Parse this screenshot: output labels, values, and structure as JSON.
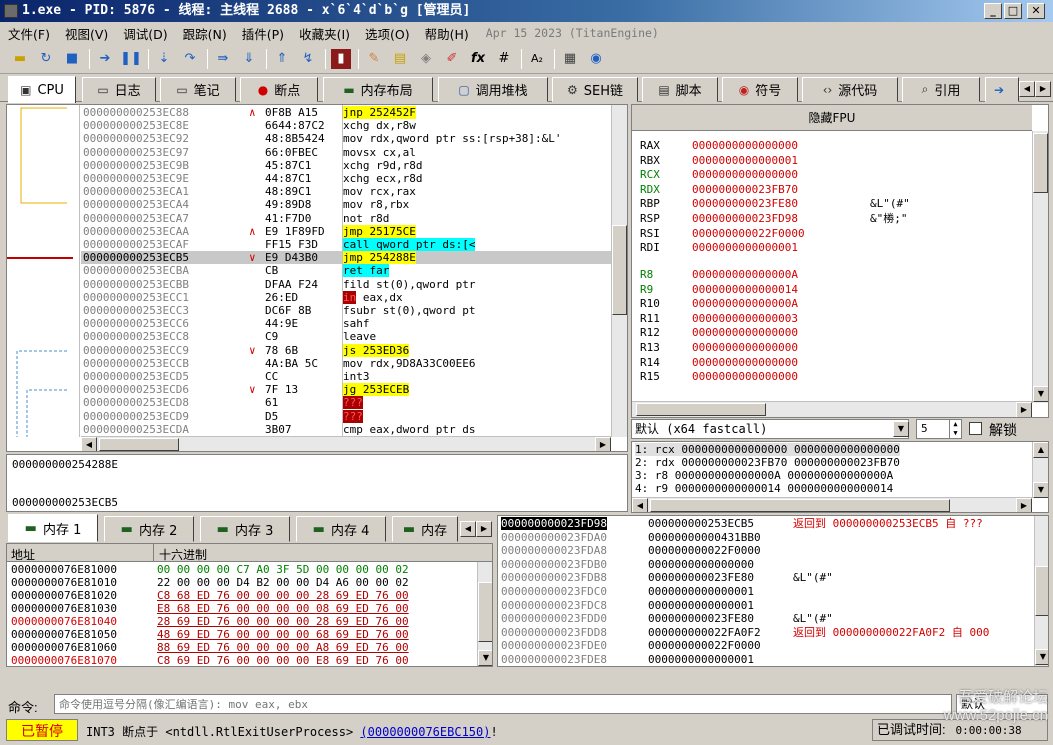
{
  "title": "1.exe - PID: 5876 - 线程: 主线程 2688 - x`6`4`d`b`g [管理员]",
  "menu": [
    "文件(F)",
    "视图(V)",
    "调试(D)",
    "跟踪(N)",
    "插件(P)",
    "收藏夹(I)",
    "选项(O)",
    "帮助(H)"
  ],
  "menu_date": "Apr 15 2023 (TitanEngine)",
  "toolbar_icons": [
    "open-icon",
    "restart-icon",
    "stop-icon",
    "run-icon",
    "pause-icon",
    "step-into-icon",
    "step-over-icon",
    "trace-into-icon",
    "trace-over-icon",
    "run-to-user-icon",
    "run-to-return-icon",
    "script-icon",
    "patch-icon",
    "comment-icon",
    "label-icon",
    "bookmark-icon",
    "function-icon",
    "hash-icon",
    "font-icon",
    "calculator-icon",
    "settings-icon"
  ],
  "tabs": [
    {
      "label": "CPU",
      "icon": "cpu-icon"
    },
    {
      "label": "日志",
      "icon": "log-icon"
    },
    {
      "label": "笔记",
      "icon": "notes-icon"
    },
    {
      "label": "断点",
      "icon": "breakpoint-icon"
    },
    {
      "label": "内存布局",
      "icon": "memory-map-icon"
    },
    {
      "label": "调用堆栈",
      "icon": "call-stack-icon"
    },
    {
      "label": "SEH链",
      "icon": "seh-icon"
    },
    {
      "label": "脚本",
      "icon": "script-icon"
    },
    {
      "label": "符号",
      "icon": "symbols-icon"
    },
    {
      "label": "源代码",
      "icon": "source-icon"
    },
    {
      "label": "引用",
      "icon": "references-icon"
    }
  ],
  "disasm": [
    {
      "addr": "000000000253EC88",
      "mark": "∧",
      "bytes": "0F8B A15",
      "instr": "jnp 252452F",
      "hl": "yel",
      "extra": ""
    },
    {
      "addr": "000000000253EC8E",
      "mark": "",
      "bytes": "6644:87C2",
      "instr": "xchg dx,r8w",
      "hl": "",
      "extra": ""
    },
    {
      "addr": "000000000253EC92",
      "mark": "",
      "bytes": "48:8B5424",
      "instr": "mov rdx,qword ptr ss:[rsp+38]:&L'",
      "hl": "",
      "extra": ""
    },
    {
      "addr": "000000000253EC97",
      "mark": "",
      "bytes": "66:0FBEC",
      "instr": "movsx cx,al",
      "hl": "",
      "extra": ""
    },
    {
      "addr": "000000000253EC9B",
      "mark": "",
      "bytes": "45:87C1",
      "instr": "xchg r9d,r8d",
      "hl": "",
      "extra": ""
    },
    {
      "addr": "000000000253EC9E",
      "mark": "",
      "bytes": "44:87C1",
      "instr": "xchg ecx,r8d",
      "hl": "",
      "extra": ""
    },
    {
      "addr": "000000000253ECA1",
      "mark": "",
      "bytes": "48:89C1",
      "instr": "mov rcx,rax",
      "hl": "",
      "extra": ""
    },
    {
      "addr": "000000000253ECA4",
      "mark": "",
      "bytes": "49:89D8",
      "instr": "mov r8,rbx",
      "hl": "",
      "extra": ""
    },
    {
      "addr": "000000000253ECA7",
      "mark": "",
      "bytes": "41:F7D0",
      "instr": "not r8d",
      "hl": "",
      "extra": ""
    },
    {
      "addr": "000000000253ECAA",
      "mark": "∧",
      "bytes": "E9 1F89FD",
      "instr": "jmp 25175CE",
      "hl": "yel",
      "extra": ""
    },
    {
      "addr": "000000000253ECAF",
      "mark": "",
      "bytes": "FF15 F3D",
      "instr": "call qword ptr ds:[<",
      "hl": "cyan",
      "extra": ""
    },
    {
      "addr": "000000000253ECB5",
      "mark": "∨",
      "bytes": "E9 D43B0",
      "instr": "jmp 254288E",
      "hl": "yel",
      "extra": ""
    },
    {
      "addr": "000000000253ECBA",
      "mark": "",
      "bytes": "CB",
      "instr": "ret far",
      "hl": "cyan",
      "extra": ""
    },
    {
      "addr": "000000000253ECBB",
      "mark": "",
      "bytes": "DFAA F24",
      "instr": "fild st(0),qword ptr",
      "hl": "",
      "extra": ""
    },
    {
      "addr": "000000000253ECC1",
      "mark": "",
      "bytes": "26:ED",
      "instr": "in eax,dx",
      "hl": "dr",
      "extra": ""
    },
    {
      "addr": "000000000253ECC3",
      "mark": "",
      "bytes": "DC6F 8B",
      "instr": "fsubr st(0),qword pt",
      "hl": "",
      "extra": ""
    },
    {
      "addr": "000000000253ECC6",
      "mark": "",
      "bytes": "44:9E",
      "instr": "sahf",
      "hl": "",
      "extra": ""
    },
    {
      "addr": "000000000253ECC8",
      "mark": "",
      "bytes": "C9",
      "instr": "leave",
      "hl": "",
      "extra": ""
    },
    {
      "addr": "000000000253ECC9",
      "mark": "∨",
      "bytes": "78 6B",
      "instr": "js 253ED36",
      "hl": "yel",
      "extra": ""
    },
    {
      "addr": "000000000253ECCB",
      "mark": "",
      "bytes": "4A:BA 5C",
      "instr": "mov rdx,9D8A33C00EE6",
      "hl": "",
      "extra": ""
    },
    {
      "addr": "000000000253ECD5",
      "mark": "",
      "bytes": "CC",
      "instr": "int3",
      "hl": "",
      "extra": ""
    },
    {
      "addr": "000000000253ECD6",
      "mark": "∨",
      "bytes": "7F 13",
      "instr": "jg 253ECEB",
      "hl": "yel",
      "extra": ""
    },
    {
      "addr": "000000000253ECD8",
      "mark": "",
      "bytes": "61",
      "instr": "???",
      "hl": "dr",
      "extra": ""
    },
    {
      "addr": "000000000253ECD9",
      "mark": "",
      "bytes": "D5",
      "instr": "???",
      "hl": "dr",
      "extra": ""
    },
    {
      "addr": "000000000253ECDA",
      "mark": "",
      "bytes": "3B07",
      "instr": "cmp eax,dword ptr ds",
      "hl": "",
      "extra": ""
    }
  ],
  "fpu_toggle": "隐藏FPU",
  "registers_a": [
    [
      "RAX",
      "0000000000000000",
      ""
    ],
    [
      "RBX",
      "0000000000000001",
      ""
    ],
    [
      "RCX",
      "0000000000000000",
      ""
    ],
    [
      "RDX",
      "000000000023FB70",
      ""
    ],
    [
      "RBP",
      "000000000023FE80",
      "&L\"(#\""
    ],
    [
      "RSP",
      "000000000023FD98",
      "&\"椦;\""
    ],
    [
      "RSI",
      "000000000022F0000",
      ""
    ],
    [
      "RDI",
      "0000000000000001",
      ""
    ]
  ],
  "registers_b": [
    [
      "R8",
      "000000000000000A"
    ],
    [
      "R9",
      "0000000000000014"
    ],
    [
      "R10",
      "000000000000000A"
    ],
    [
      "R11",
      "0000000000000003"
    ],
    [
      "R12",
      "0000000000000000"
    ],
    [
      "R13",
      "0000000000000000"
    ],
    [
      "R14",
      "0000000000000000"
    ],
    [
      "R15",
      "0000000000000000"
    ]
  ],
  "callconv": {
    "selected": "默认 (x64 fastcall)",
    "count": "5",
    "lock_label": "解锁"
  },
  "args": [
    "1: rcx 0000000000000000 0000000000000000",
    "2: rdx 000000000023FB70 000000000023FB70",
    "3: r8 000000000000000A 000000000000000A",
    "4: r9 0000000000000014 0000000000000014"
  ],
  "info_lines": [
    "000000000254288E",
    "000000000253ECB5"
  ],
  "mem_tabs": [
    "内存 1",
    "内存 2",
    "内存 3",
    "内存 4",
    "内存"
  ],
  "dump_headers": {
    "addr": "地址",
    "hex": "十六进制"
  },
  "dump": [
    {
      "addr": "0000000076E81000",
      "bytes": "00 00 00 00 C7 A0 3F 5D 00 00 00 00 02",
      "red": false
    },
    {
      "addr": "0000000076E81010",
      "bytes": "22 00 00 00 D4 B2 00 00 D4 A6 00 00 02",
      "red": false
    },
    {
      "addr": "0000000076E81020",
      "bytes": "C8 68 ED 76 00 00 00 00 28 69 ED 76 00",
      "red": false
    },
    {
      "addr": "0000000076E81030",
      "bytes": "E8 68 ED 76 00 00 00 00 08 69 ED 76 00",
      "red": false
    },
    {
      "addr": "0000000076E81040",
      "bytes": "28 69 ED 76 00 00 00 00 28 69 ED 76 00",
      "red": true
    },
    {
      "addr": "0000000076E81050",
      "bytes": "48 69 ED 76 00 00 00 00 68 69 ED 76 00",
      "red": false
    },
    {
      "addr": "0000000076E81060",
      "bytes": "88 69 ED 76 00 00 00 00 A8 69 ED 76 00",
      "red": false
    },
    {
      "addr": "0000000076E81070",
      "bytes": "C8 69 ED 76 00 00 00 00 E8 69 ED 76 00",
      "red": true
    }
  ],
  "stack": [
    {
      "addr": "000000000023FD98",
      "val": "000000000253ECB5",
      "cmt": "返回到 000000000253ECB5 自 ???",
      "sel": true
    },
    {
      "addr": "000000000023FDA0",
      "val": "00000000000431BB0",
      "cmt": "",
      "sel": false
    },
    {
      "addr": "000000000023FDA8",
      "val": "000000000022F0000",
      "cmt": "",
      "sel": false
    },
    {
      "addr": "000000000023FDB0",
      "val": "0000000000000000",
      "cmt": "",
      "sel": false
    },
    {
      "addr": "000000000023FDB8",
      "val": "000000000023FE80",
      "cmt": "&L\"(#\"",
      "sel": false
    },
    {
      "addr": "000000000023FDC0",
      "val": "0000000000000001",
      "cmt": "",
      "sel": false
    },
    {
      "addr": "000000000023FDC8",
      "val": "0000000000000001",
      "cmt": "",
      "sel": false
    },
    {
      "addr": "000000000023FDD0",
      "val": "000000000023FE80",
      "cmt": "&L\"(#\"",
      "sel": false
    },
    {
      "addr": "000000000023FDD8",
      "val": "000000000022FA0F2",
      "cmt": "返回到 000000000022FA0F2 自 000",
      "sel": false
    },
    {
      "addr": "000000000023FDE0",
      "val": "000000000022F0000",
      "cmt": "",
      "sel": false
    },
    {
      "addr": "000000000023FDE8",
      "val": "0000000000000001",
      "cmt": "",
      "sel": false
    }
  ],
  "command": {
    "label": "命令:",
    "placeholder": "命令使用逗号分隔(像汇编语言): mov eax, ebx",
    "right": "默认"
  },
  "status": {
    "state": "已暂停",
    "msg": "INT3 断点于 <ntdll.RtlExitUserProcess> (0000000076EBC150)!",
    "link": "(0000000076EBC150)",
    "time_label": "已调试时间:",
    "time": "0:00:00:38"
  },
  "watermark": "吾爱破解论坛 www.52pojie.cn",
  "colors": {
    "title_bar": "#0a246a",
    "paused": "#ffff00",
    "accent_red": "#d40000"
  }
}
